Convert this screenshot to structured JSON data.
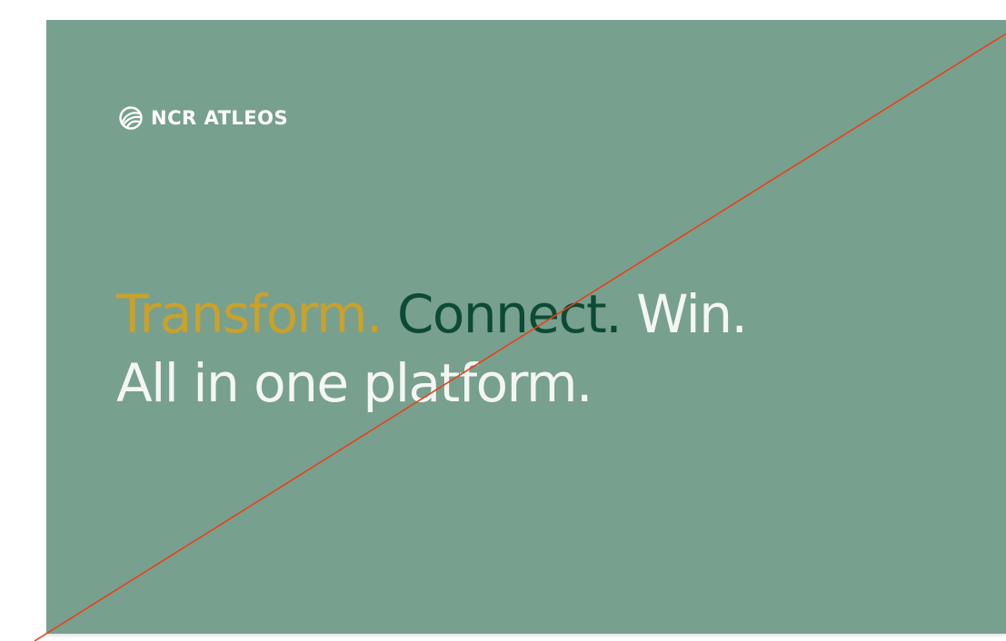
{
  "brand": {
    "logo_icon": "globe-swirl-icon",
    "name": "NCR ATLEOS"
  },
  "headline": {
    "word_1": "Transform.",
    "word_2": "Connect.",
    "word_3": "Win.",
    "line_2": "All in one platform."
  },
  "colors": {
    "background": "#78a08e",
    "transform": "#c9a12c",
    "connect": "#0d4a36",
    "text_light": "#f4f6f3",
    "strike_line": "#e8401c"
  }
}
